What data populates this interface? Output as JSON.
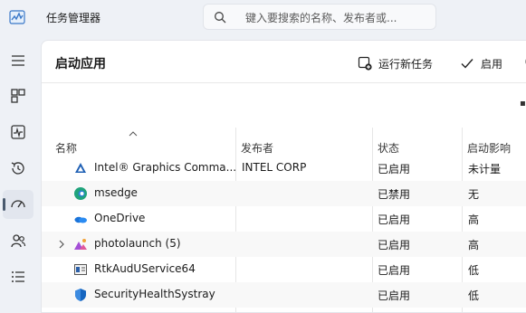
{
  "window": {
    "title": "任务管理器"
  },
  "search": {
    "placeholder": "键入要搜索的名称、发布者或..."
  },
  "page": {
    "title": "启动应用"
  },
  "toolbar": {
    "run_new_task": "运行新任务",
    "enable": "启用"
  },
  "columns": {
    "name": "名称",
    "publisher": "发布者",
    "status": "状态",
    "impact": "启动影响"
  },
  "rows": [
    {
      "name": "Intel® Graphics Comma...",
      "publisher": "INTEL CORP",
      "status": "已启用",
      "impact": "未计量",
      "icon": "intel-graphics-icon"
    },
    {
      "name": "msedge",
      "publisher": "",
      "status": "已禁用",
      "impact": "无",
      "icon": "edge-icon"
    },
    {
      "name": "OneDrive",
      "publisher": "",
      "status": "已启用",
      "impact": "高",
      "icon": "onedrive-icon"
    },
    {
      "name": "photolaunch (5)",
      "publisher": "",
      "status": "已启用",
      "impact": "高",
      "icon": "photos-icon"
    },
    {
      "name": "RtkAudUService64",
      "publisher": "",
      "status": "已启用",
      "impact": "低",
      "icon": "realtek-audio-icon"
    },
    {
      "name": "SecurityHealthSystray",
      "publisher": "",
      "status": "已启用",
      "impact": "低",
      "icon": "security-shield-icon"
    }
  ],
  "colors": {
    "accent": "#4a5a6e",
    "edge": "#1fa37b",
    "onedrive": "#1a73d9",
    "photos": "#a44fd6",
    "shield": "#1565c0"
  }
}
